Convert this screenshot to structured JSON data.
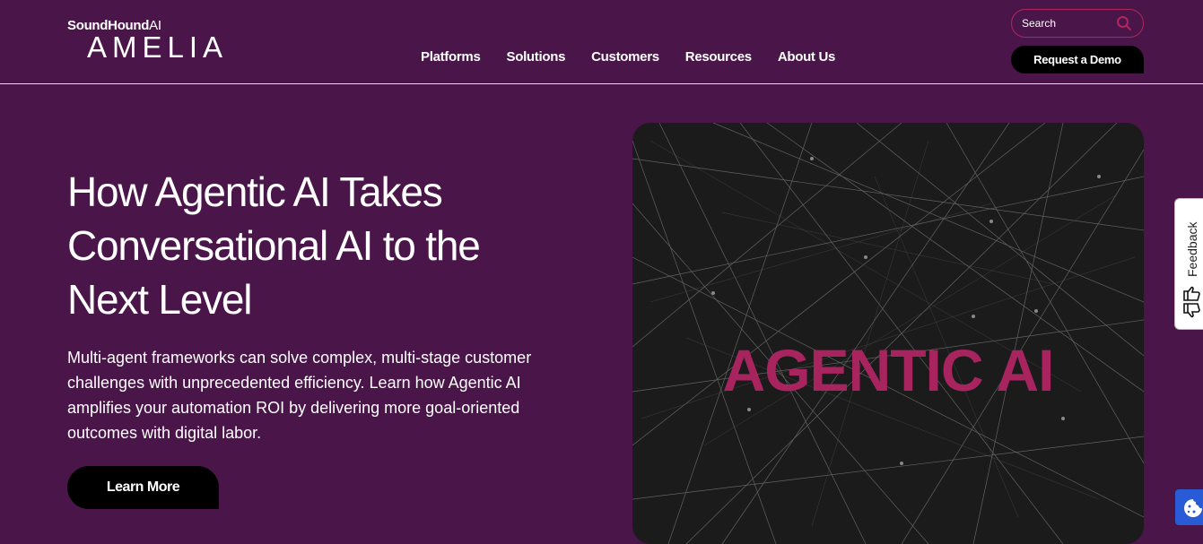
{
  "header": {
    "logo": {
      "brand": "SoundHound",
      "brand_suffix": "AI",
      "product": "AMELIA"
    },
    "nav": [
      {
        "label": "Platforms"
      },
      {
        "label": "Solutions"
      },
      {
        "label": "Customers"
      },
      {
        "label": "Resources"
      },
      {
        "label": "About Us"
      }
    ],
    "search": {
      "placeholder": "Search",
      "icon": "search-icon"
    },
    "demo_button": "Request a Demo"
  },
  "hero": {
    "title": "How Agentic AI Takes Conversational AI to the Next Level",
    "description": "Multi-agent frameworks can solve complex, multi-stage customer challenges with unprecedented efficiency. Learn how Agentic AI amplifies your automation ROI by delivering more goal-oriented outcomes with digital labor.",
    "button": "Learn More",
    "image_text": "AGENTIC AI"
  },
  "feedback_tab": {
    "label": "Feedback",
    "icon": "thumbs-up-down-icon"
  },
  "cookie_button": {
    "icon": "cookie-icon"
  },
  "colors": {
    "background": "#4a1549",
    "accent": "#a8245f",
    "button": "#000000",
    "cookie": "#2a5bd7"
  }
}
